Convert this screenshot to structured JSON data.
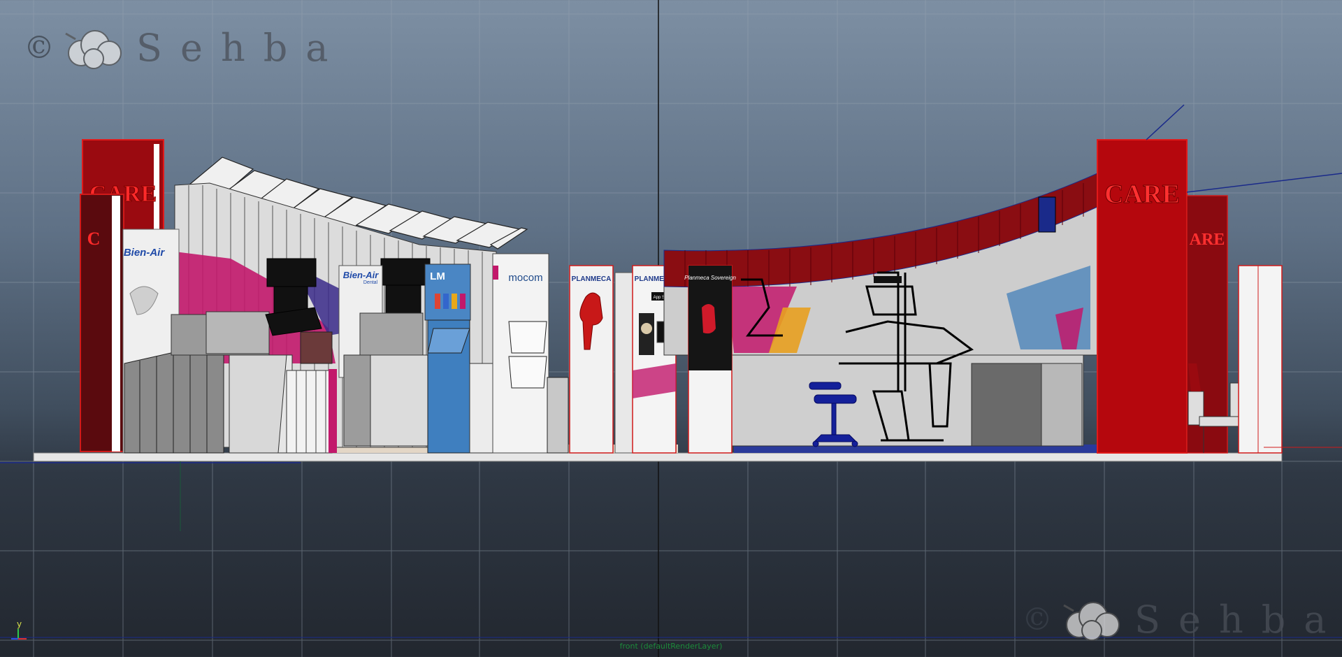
{
  "viewport": {
    "camera_label": "front (defaultRenderLayer)",
    "axis_label": "y"
  },
  "watermark": {
    "copyright": "©",
    "word": "Sehba"
  },
  "booth": {
    "pillar_text": "CARE",
    "brands": {
      "bienair": "Bien-Air",
      "bienair_sub": "Dental",
      "lm": "LM",
      "mocom": "mocom",
      "planmeca1": "PLANMECA",
      "planmeca2": "PLANMECA",
      "planmeca_sovereign": "Planmeca Sovereign",
      "appstore": "App Store"
    }
  },
  "colors": {
    "red": "#b5070d",
    "dark_red": "#7a0a10",
    "magenta": "#c2186b",
    "blue": "#3f7fbf",
    "navy": "#14209a"
  }
}
